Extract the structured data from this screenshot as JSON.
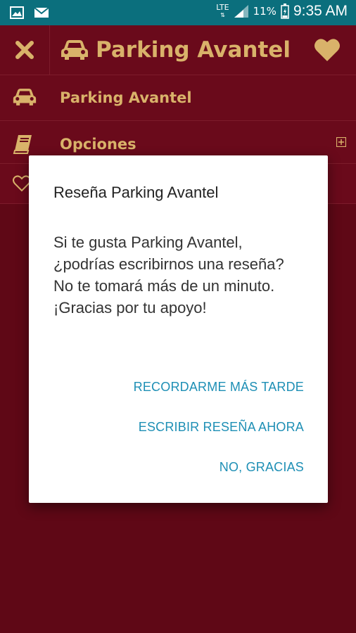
{
  "status_bar": {
    "network": "LTE",
    "battery_percent": "11%",
    "time": "9:35 AM"
  },
  "app_bar": {
    "title": "Parking Avantel",
    "close_icon": "close-icon",
    "car_icon": "car-icon",
    "favorite_icon": "heart-icon"
  },
  "menu": {
    "items": [
      {
        "label": "Parking Avantel",
        "icon": "car-icon"
      },
      {
        "label": "Opciones",
        "icon": "book-icon",
        "expand_icon": "plus-square-icon"
      },
      {
        "label": "",
        "icon": "heart-outline-icon"
      }
    ]
  },
  "dialog": {
    "title": "Reseña Parking Avantel",
    "message": "Si te gusta Parking Avantel, ¿podrías escribirnos una reseña? No te tomará más de un minuto. ¡Gracias por tu apoyo!",
    "buttons": {
      "later": "RECORDARME MÁS TARDE",
      "review_now": "ESCRIBIR RESEÑA AHORA",
      "no_thanks": "NO, GRACIAS"
    }
  },
  "colors": {
    "background": "#5f0816",
    "accent_gold": "#d9b26a",
    "status_bar": "#0b6f7d",
    "dialog_button": "#1e8fb5"
  }
}
